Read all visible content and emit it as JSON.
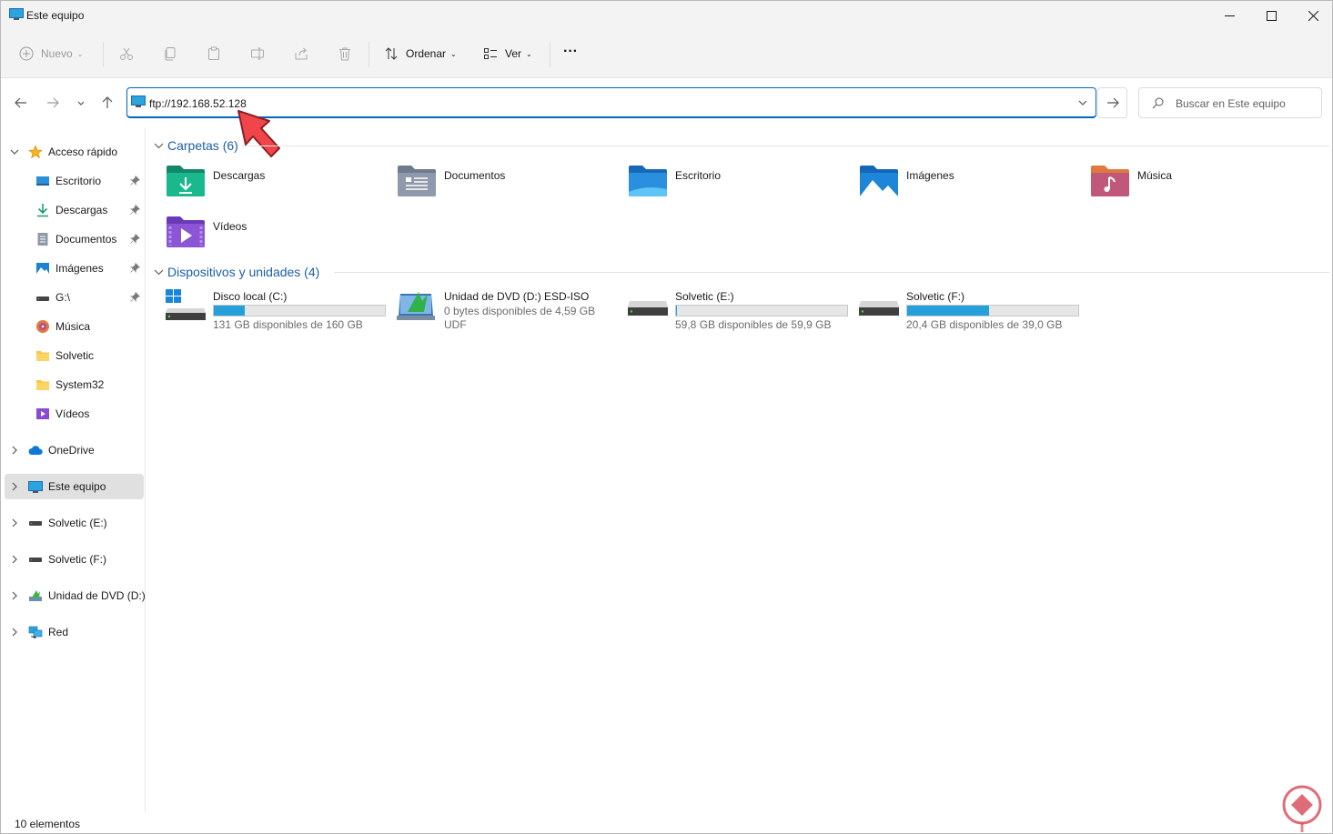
{
  "window": {
    "title": "Este equipo"
  },
  "toolbar": {
    "new_label": "Nuevo",
    "sort_label": "Ordenar",
    "view_label": "Ver",
    "more_label": "···"
  },
  "address": {
    "value": "ftp://192.168.52.128",
    "search_placeholder": "Buscar en Este equipo"
  },
  "sidebar": {
    "quick_access": "Acceso rápido",
    "quick_items": [
      {
        "label": "Escritorio",
        "icon": "desktop-icon",
        "pinned": true
      },
      {
        "label": "Descargas",
        "icon": "download-icon",
        "pinned": true
      },
      {
        "label": "Documentos",
        "icon": "document-icon",
        "pinned": true
      },
      {
        "label": "Imágenes",
        "icon": "image-icon",
        "pinned": true
      },
      {
        "label": "G:\\",
        "icon": "drive-icon",
        "pinned": true
      },
      {
        "label": "Música",
        "icon": "music-icon",
        "pinned": false
      },
      {
        "label": "Solvetic",
        "icon": "folder-icon",
        "pinned": false
      },
      {
        "label": "System32",
        "icon": "folder-icon",
        "pinned": false
      },
      {
        "label": "Vídeos",
        "icon": "video-icon",
        "pinned": false
      }
    ],
    "roots": [
      {
        "label": "OneDrive",
        "icon": "cloud-icon"
      },
      {
        "label": "Este equipo",
        "icon": "pc-icon",
        "selected": true
      },
      {
        "label": "Solvetic (E:)",
        "icon": "drive-icon"
      },
      {
        "label": "Solvetic (F:)",
        "icon": "drive-icon"
      },
      {
        "label": "Unidad de DVD (D:)",
        "icon": "dvd-icon"
      },
      {
        "label": "Red",
        "icon": "network-icon"
      }
    ]
  },
  "main": {
    "folders_header": "Carpetas (6)",
    "folders": [
      {
        "label": "Descargas",
        "icon": "downloads-folder-icon"
      },
      {
        "label": "Documentos",
        "icon": "documents-folder-icon"
      },
      {
        "label": "Escritorio",
        "icon": "desktop-folder-icon"
      },
      {
        "label": "Imágenes",
        "icon": "pictures-folder-icon"
      },
      {
        "label": "Música",
        "icon": "music-folder-icon"
      },
      {
        "label": "Vídeos",
        "icon": "videos-folder-icon"
      }
    ],
    "devices_header": "Dispositivos y unidades (4)",
    "devices": [
      {
        "label": "Disco local (C:)",
        "info": "131 GB disponibles de 160 GB",
        "used_fraction": 0.18,
        "icon": "windows-drive-icon"
      },
      {
        "label": "Unidad de DVD (D:) ESD-ISO",
        "info": "0 bytes disponibles de 4,59 GB",
        "info2": "UDF",
        "icon": "dvd-drive-icon"
      },
      {
        "label": "Solvetic (E:)",
        "info": "59,8 GB disponibles de 59,9 GB",
        "used_fraction": 0.002,
        "icon": "drive-icon"
      },
      {
        "label": "Solvetic (F:)",
        "info": "20,4 GB disponibles de 39,0 GB",
        "used_fraction": 0.477,
        "icon": "drive-icon"
      }
    ]
  },
  "status": {
    "count": "10 elementos"
  },
  "colors": {
    "accent": "#0067c0",
    "bar_fill": "#26a0da",
    "group_header": "#1b5fa6"
  }
}
